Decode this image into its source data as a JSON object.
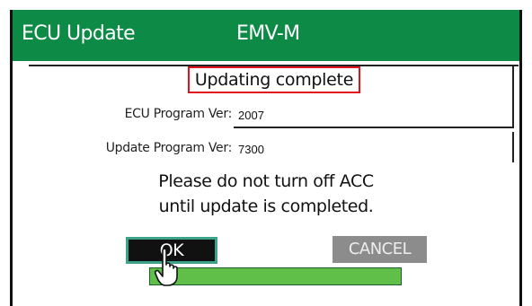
{
  "header": {
    "title": "ECU Update",
    "model": "EMV-M",
    "background_color": "#0e8a47"
  },
  "status": {
    "text": "Updating complete",
    "border_color": "#e1141b"
  },
  "fields": [
    {
      "label": "ECU Program Ver:",
      "value": "2007"
    },
    {
      "label": "Update Program Ver:",
      "value": "7300"
    }
  ],
  "message": {
    "line1": "Please do not turn off ACC",
    "line2": "until update is completed."
  },
  "buttons": {
    "ok_label": "OK",
    "cancel_label": "CANCEL"
  },
  "progress": {
    "fraction": 1.0,
    "fill_color": "#5fbf48"
  },
  "icons": {
    "pointer": "hand-pointer-icon"
  }
}
